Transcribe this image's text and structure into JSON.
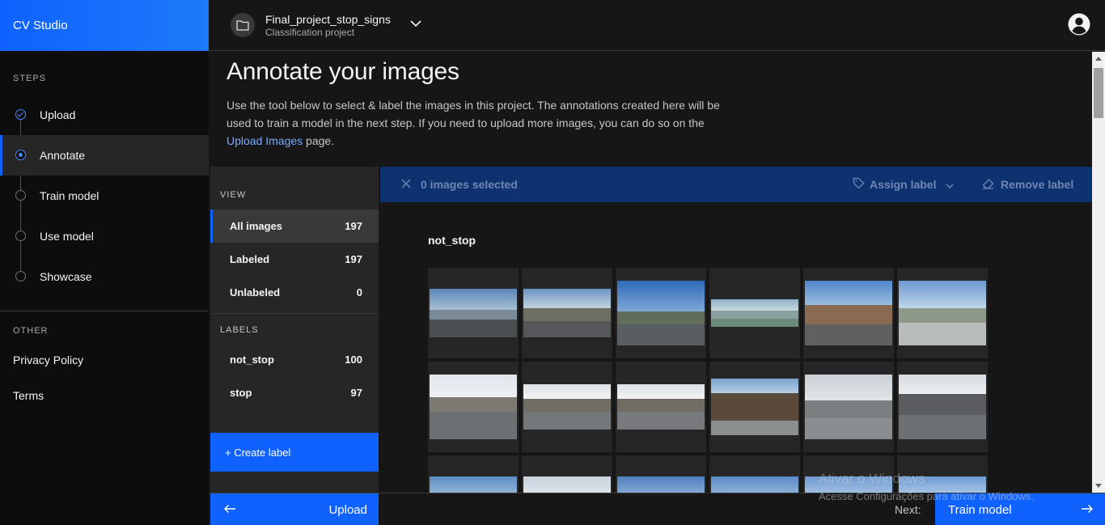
{
  "app": {
    "brand": "CV Studio"
  },
  "project": {
    "name": "Final_project_stop_signs",
    "type": "Classification project"
  },
  "sidebar": {
    "steps_title": "STEPS",
    "steps": [
      {
        "label": "Upload",
        "state": "done"
      },
      {
        "label": "Annotate",
        "state": "current"
      },
      {
        "label": "Train model",
        "state": "pending"
      },
      {
        "label": "Use model",
        "state": "pending"
      },
      {
        "label": "Showcase",
        "state": "pending"
      }
    ],
    "other_title": "OTHER",
    "other_links": [
      "Privacy Policy",
      "Terms"
    ]
  },
  "main": {
    "title": "Annotate your images",
    "desc_before": "Use the tool below to select & label the images in this project. The annotations created here will be used to train a model in the next step. If you need to upload more images, you can do so on the ",
    "desc_link": "Upload Images",
    "desc_after": " page."
  },
  "panel": {
    "view_title": "VIEW",
    "views": [
      {
        "label": "All images",
        "count": "197"
      },
      {
        "label": "Labeled",
        "count": "197"
      },
      {
        "label": "Unlabeled",
        "count": "0"
      }
    ],
    "labels_title": "LABELS",
    "labels": [
      {
        "label": "not_stop",
        "count": "100"
      },
      {
        "label": "stop",
        "count": "97"
      }
    ],
    "create_label": "+ Create label"
  },
  "selection": {
    "count_text": "0 images selected",
    "assign_label": "Assign label",
    "remove_label": "Remove label"
  },
  "gallery": {
    "group_title": "not_stop"
  },
  "footer": {
    "back_label": "Upload",
    "next_prefix": "Next:",
    "next_label": "Train model"
  },
  "watermark": {
    "line1": "Ativar o Windows",
    "line2": "Acesse Configurações para ativar o Windows."
  },
  "colors": {
    "accent": "#0f62fe",
    "selection_bar": "#0e3170",
    "link": "#78a9ff"
  }
}
